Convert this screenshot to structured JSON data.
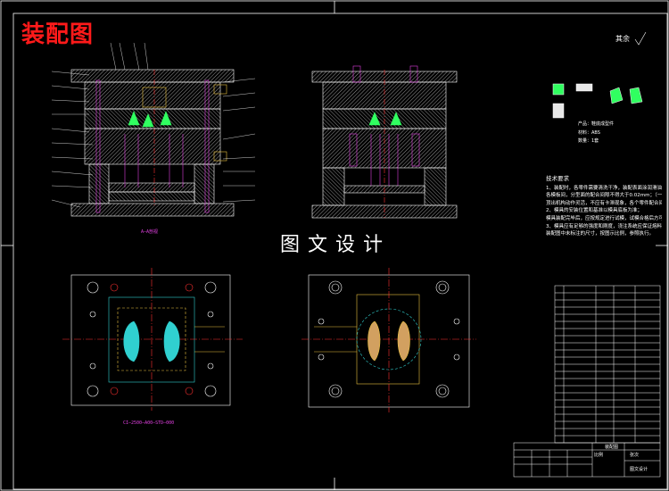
{
  "sheet": {
    "title": "装配图",
    "watermark": "图文设计",
    "roughness_label": "其余"
  },
  "technical_requirements": {
    "heading": "技术要求",
    "lines": [
      "1、装配时，各零件需要清洗干净，装配表面涂润滑油；",
      "各模板间，分型面的配合间隙不得大于0.02mm；（一0.03mm）以内；",
      "顶出机构动作灵活，不应有卡滞现象，各个零件配合间隙合理；",
      "2、模具的安装位置和基准以模具底板为准；",
      "模具装配完毕后，应按规定进行试模，试模合格后方可使用；",
      "3、模具应有足够的强度和刚度，浇注系统应保证熔料顺利充填；",
      "装配图中未标注的尺寸，按图示比例，参照执行。"
    ]
  },
  "part_spec": {
    "lines": [
      "产品：鞋底成型件",
      "材料：ABS",
      "数量：1套"
    ]
  },
  "captions": {
    "section_view": "A—A剖视",
    "plan_view": "CI—2500—A00—STD—000"
  },
  "title_block": {
    "drawing_name": "装配图",
    "school": "图文设计",
    "scale_label": "比例",
    "sheet_label": "张次"
  },
  "colors": {
    "background": "#000000",
    "line": "#ffffff",
    "hatch": "#9a9a9a",
    "center": "#ff3030",
    "accent": "#ff40ff",
    "part": "#30ff60",
    "cyan": "#30d0d0",
    "yellow": "#e8c040"
  }
}
